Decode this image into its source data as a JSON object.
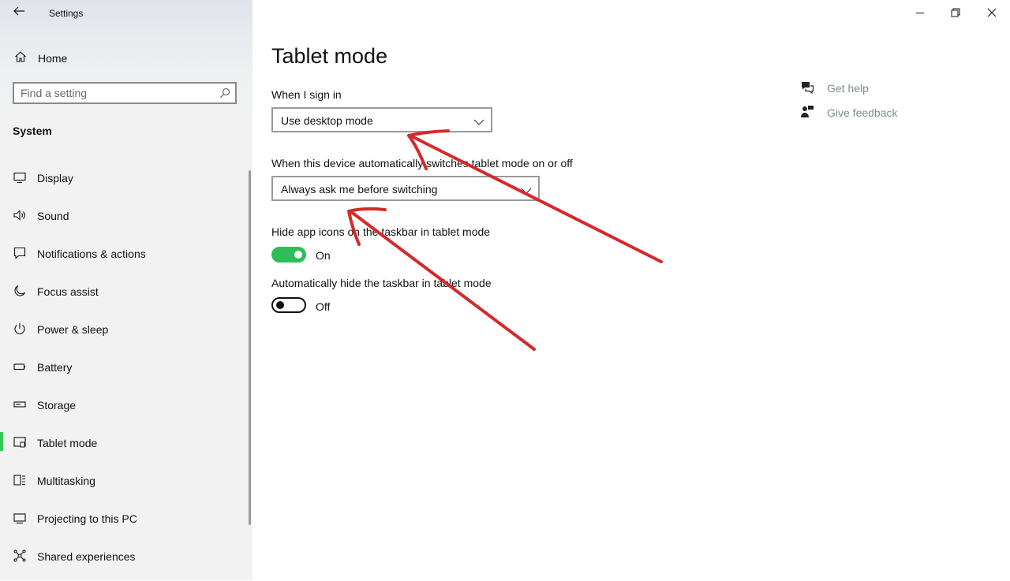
{
  "window": {
    "title": "Settings",
    "back_icon": "back-arrow-icon",
    "controls": [
      "minimize-icon",
      "restore-icon",
      "close-icon"
    ]
  },
  "sidebar": {
    "home_label": "Home",
    "search_placeholder": "Find a setting",
    "section_title": "System",
    "items": [
      {
        "label": "Display",
        "icon": "display-icon"
      },
      {
        "label": "Sound",
        "icon": "sound-icon"
      },
      {
        "label": "Notifications & actions",
        "icon": "notifications-icon"
      },
      {
        "label": "Focus assist",
        "icon": "moon-icon"
      },
      {
        "label": "Power & sleep",
        "icon": "power-icon"
      },
      {
        "label": "Battery",
        "icon": "battery-icon"
      },
      {
        "label": "Storage",
        "icon": "storage-icon"
      },
      {
        "label": "Tablet mode",
        "icon": "tablet-icon",
        "active": true
      },
      {
        "label": "Multitasking",
        "icon": "multitasking-icon"
      },
      {
        "label": "Projecting to this PC",
        "icon": "projecting-icon"
      },
      {
        "label": "Shared experiences",
        "icon": "shared-experiences-icon"
      }
    ]
  },
  "main": {
    "title": "Tablet mode",
    "sign_in_label": "When I sign in",
    "sign_in_value": "Use desktop mode",
    "auto_switch_label": "When this device automatically switches tablet mode on or off",
    "auto_switch_value": "Always ask me before switching",
    "hide_icons_label": "Hide app icons on the taskbar in tablet mode",
    "hide_icons_state": "On",
    "hide_icons_on": true,
    "hide_taskbar_label": "Automatically hide the taskbar in tablet mode",
    "hide_taskbar_state": "Off",
    "hide_taskbar_on": false
  },
  "help": {
    "get_help": "Get help",
    "give_feedback": "Give feedback"
  },
  "annotation_color": "#d42a2a",
  "toggle_on_color": "#2ebd59",
  "active_indicator_color": "#34c759"
}
